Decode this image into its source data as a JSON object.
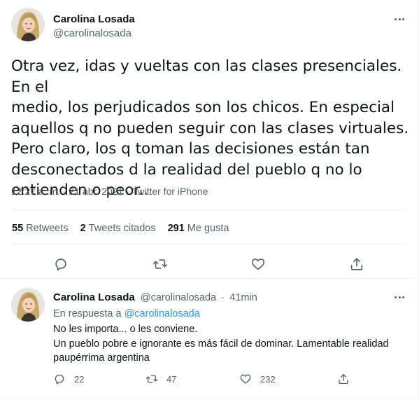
{
  "main_tweet": {
    "author_name": "Carolina Losada",
    "author_handle": "@carolinalosada",
    "text_lines": [
      "Otra vez, idas y vueltas con las clases presenciales. En el",
      "medio, los perjudicados son los chicos. En especial",
      "aquellos q no pueden seguir con las clases virtuales.",
      "Pero claro, los q toman las decisiones están tan",
      "desconectados d la realidad del pueblo q no lo",
      "entienden o peor.."
    ],
    "time": "12:27 a. m.",
    "separator": "·",
    "date": "21 abr. 2021",
    "source": "Twitter for iPhone",
    "stats": {
      "retweets_count": "55",
      "retweets_label": "Retweets",
      "quotes_count": "2",
      "quotes_label": "Tweets citados",
      "likes_count": "291",
      "likes_label": "Me gusta"
    },
    "actions": [
      "reply-icon",
      "retweet-icon",
      "like-icon",
      "share-icon"
    ]
  },
  "reply_tweet": {
    "author_name": "Carolina Losada",
    "author_handle": "@carolinalosada",
    "separator": "·",
    "time_ago": "41min",
    "in_reply_prefix": "En respuesta a",
    "in_reply_handle": "@carolinalosada",
    "text_lines": [
      "No les importa... o les conviene.",
      "Un pueblo pobre e ignorante es más fácil de dominar. Lamentable realidad",
      "paupérrima argentina"
    ],
    "reply_count": "22",
    "retweet_count": "47",
    "like_count": "232"
  },
  "colors": {
    "text": "#0f1419",
    "secondary": "#536471",
    "link": "#1d9bf0",
    "divider": "#eff3f4"
  }
}
